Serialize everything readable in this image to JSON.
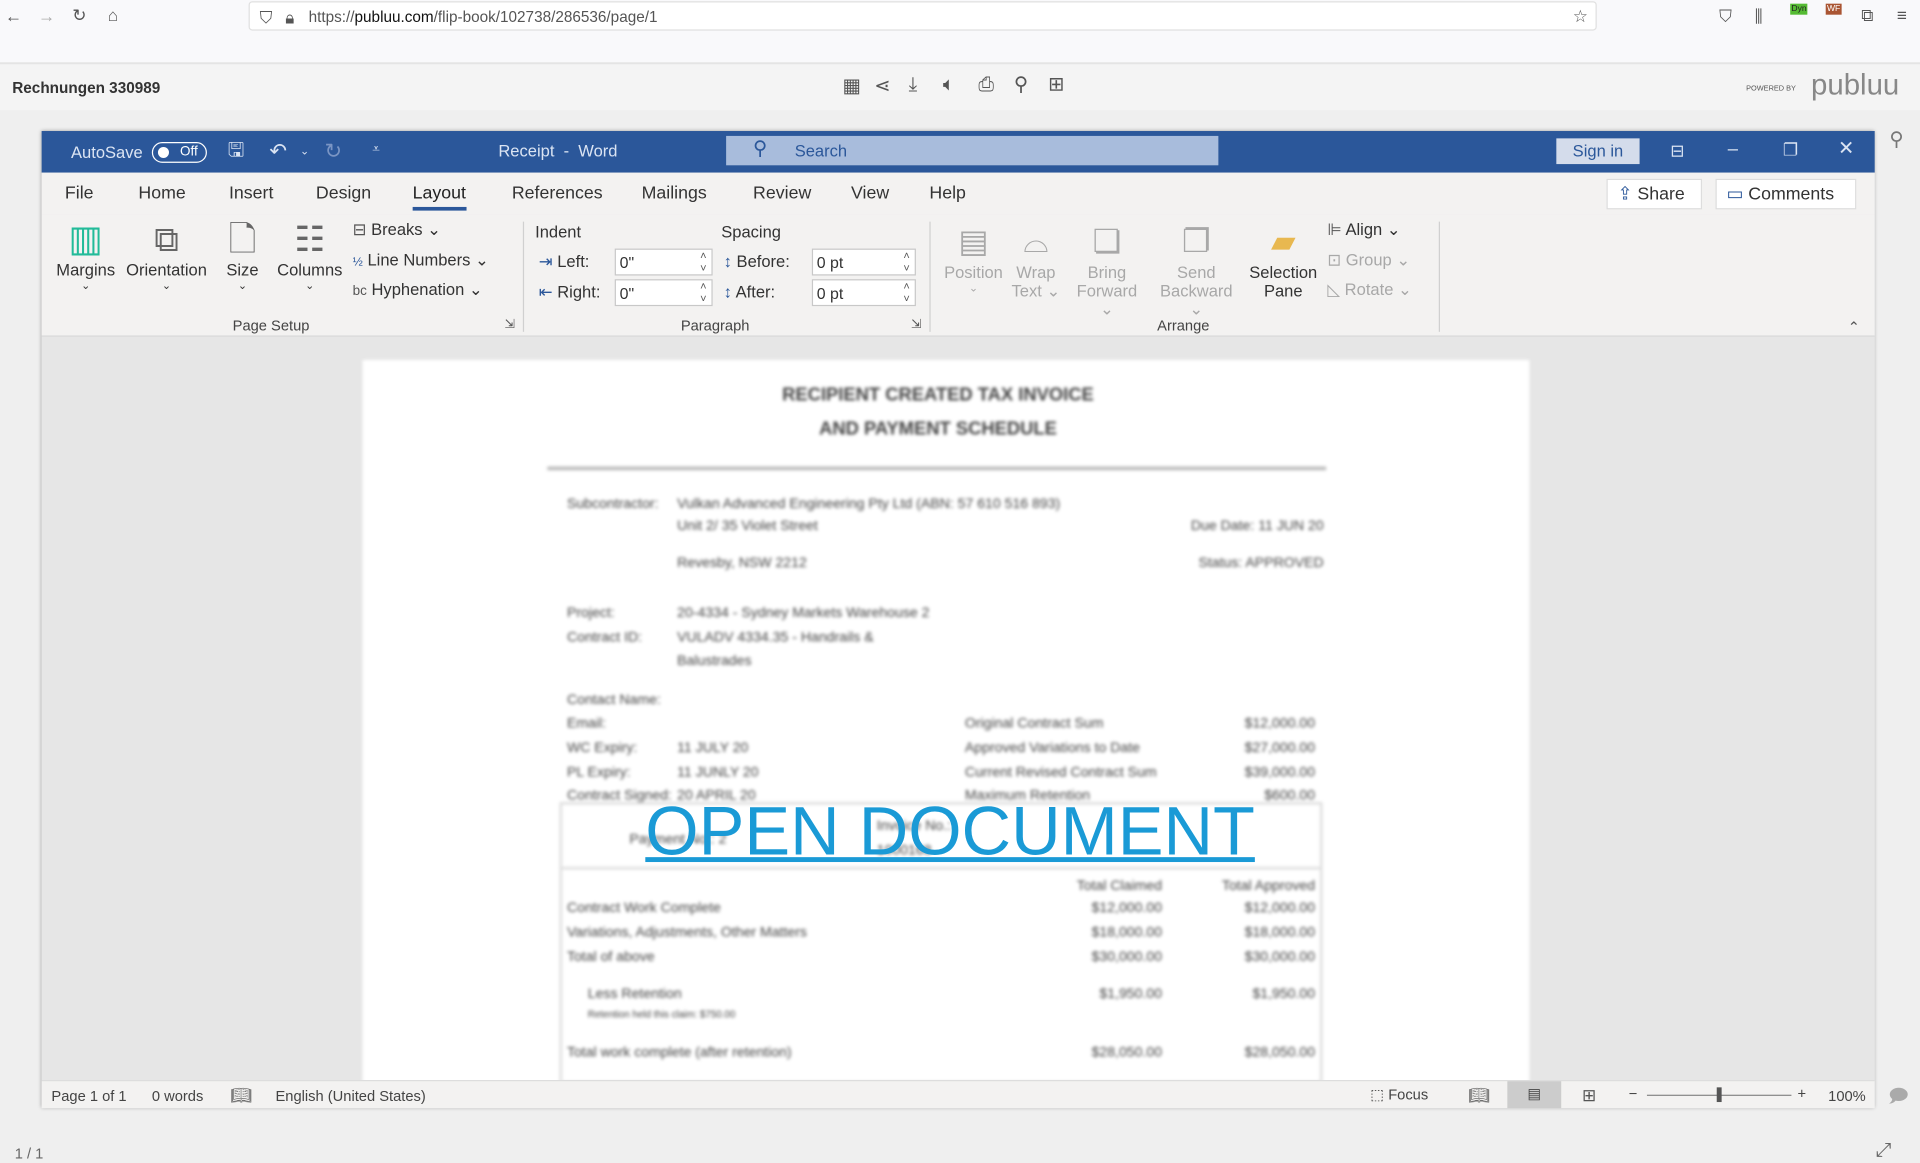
{
  "browser": {
    "url_prefix": "https://",
    "url_domain": "publuu.com",
    "url_path": "/flip-book/102738/286536/page/1",
    "ext_labels": [
      "Dyn",
      "WF"
    ]
  },
  "publuu": {
    "title": "Rechnungen 330989",
    "powered_by": "POWERED BY",
    "brand": "publuu",
    "page_indicator": "1 / 1"
  },
  "word": {
    "autosave": "AutoSave",
    "autosave_state": "Off",
    "title": "Receipt  -  Word",
    "search": "Search",
    "sign_in": "Sign in",
    "tabs": [
      "File",
      "Home",
      "Insert",
      "Design",
      "Layout",
      "References",
      "Mailings",
      "Review",
      "View",
      "Help"
    ],
    "active_tab": "Layout",
    "share": "Share",
    "comments": "Comments",
    "page_setup": {
      "margins": "Margins",
      "orientation": "Orientation",
      "size": "Size",
      "columns": "Columns",
      "breaks": "Breaks",
      "line_numbers": "Line Numbers",
      "hyphenation": "Hyphenation",
      "group": "Page Setup"
    },
    "paragraph": {
      "indent": "Indent",
      "spacing": "Spacing",
      "left": "Left:",
      "right": "Right:",
      "before": "Before:",
      "after": "After:",
      "left_val": "0\"",
      "right_val": "0\"",
      "before_val": "0 pt",
      "after_val": "0 pt",
      "group": "Paragraph"
    },
    "arrange": {
      "position": "Position",
      "wrap1": "Wrap",
      "wrap2": "Text",
      "bring1": "Bring",
      "bring2": "Forward",
      "send1": "Send",
      "send2": "Backward",
      "sel1": "Selection",
      "sel2": "Pane",
      "align": "Align",
      "group_btn": "Group",
      "rotate": "Rotate",
      "group": "Arrange"
    },
    "status": {
      "page": "Page 1 of 1",
      "words": "0 words",
      "language": "English (United States)",
      "focus": "Focus",
      "zoom": "100%"
    }
  },
  "document": {
    "title1": "RECIPIENT CREATED TAX INVOICE",
    "title2": "AND PAYMENT SCHEDULE",
    "subcontractor_label": "Subcontractor:",
    "subcontractor": "Vulkan Advanced Engineering Pty Ltd (ABN: 57 610 516 893)",
    "address1": "Unit 2/ 35 Violet Street",
    "address2": "Revesby, NSW 2212",
    "due_date": "Due Date: 11 JUN 20",
    "status": "Status: APPROVED",
    "project_label": "Project:",
    "project": "20-4334 - Sydney Markets Warehouse 2",
    "contract_label": "Contract ID:",
    "contract1": "VULADV 4334.35 - Handrails &",
    "contract2": "Balustrades",
    "rows": [
      {
        "label": "Contact Name:",
        "value": "",
        "k": "",
        "v": ""
      },
      {
        "label": "Email:",
        "value": "",
        "k": "Original Contract Sum",
        "v": "$12,000.00"
      },
      {
        "label": "WC Expiry:",
        "value": "11 JULY 20",
        "k": "Approved Variations to Date",
        "v": "$27,000.00"
      },
      {
        "label": "PL Expiry:",
        "value": "11 JUNLY 20",
        "k": "Current Revised Contract Sum",
        "v": "$39,000.00"
      },
      {
        "label": "Contract Signed:",
        "value": "20 APRIL 20",
        "k": "Maximum Retention",
        "v": "$600.00"
      }
    ],
    "payment_no": "Payment No.: 2",
    "invoice_label": "Invoice No.:",
    "invoice_no": "1000168",
    "col_claimed": "Total Claimed",
    "col_approved": "Total Approved",
    "lines": [
      {
        "label": "Contract Work Complete",
        "claimed": "$12,000.00",
        "approved": "$12,000.00"
      },
      {
        "label": "Variations, Adjustments, Other Matters",
        "claimed": "$18,000.00",
        "approved": "$18,000.00"
      },
      {
        "label": "Total of above",
        "claimed": "$30,000.00",
        "approved": "$30,000.00"
      },
      {
        "label": "Less Retention",
        "claimed": "$1,950.00",
        "approved": "$1,950.00"
      },
      {
        "label": "Total work complete (after retention)",
        "claimed": "$28,050.00",
        "approved": "$28,050.00"
      }
    ],
    "retention_note": "Retention held this claim: $750.00",
    "overlay_link": "OPEN DOCUMENT"
  },
  "colors": {
    "word_blue": "#2b579a",
    "link": "#1a9ad6"
  }
}
